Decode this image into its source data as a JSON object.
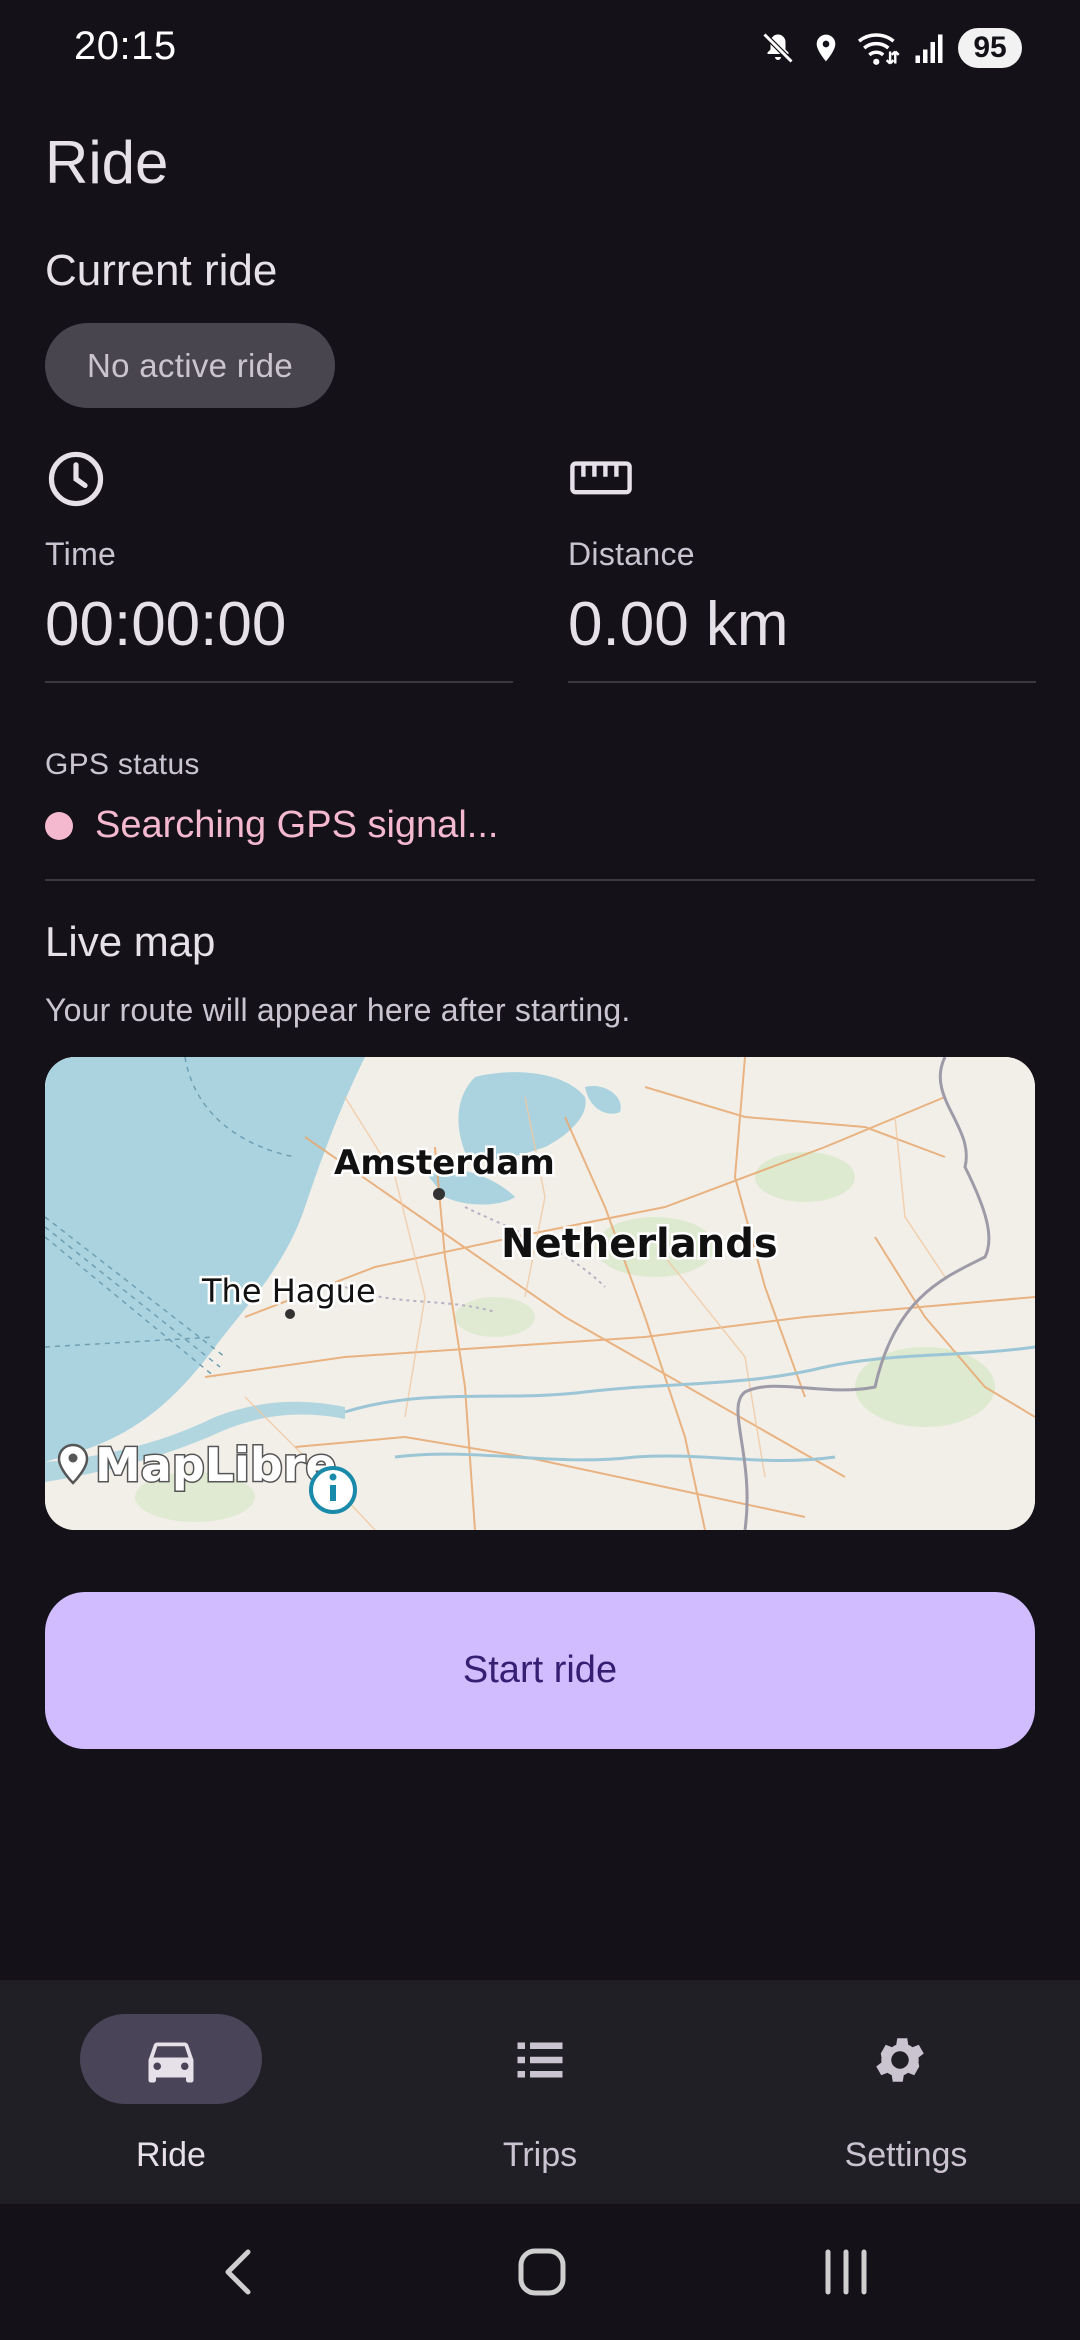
{
  "status_bar": {
    "time": "20:15",
    "battery": "95",
    "icons": [
      "mute-icon",
      "location-icon",
      "wifi-icon",
      "signal-icon"
    ]
  },
  "page": {
    "title": "Ride"
  },
  "current_ride": {
    "heading": "Current ride",
    "status_chip": "No active ride"
  },
  "stats": {
    "time": {
      "label": "Time",
      "value": "00:00:00",
      "icon": "clock-icon"
    },
    "distance": {
      "label": "Distance",
      "value": "0.00 km",
      "icon": "ruler-icon"
    }
  },
  "gps": {
    "label": "GPS status",
    "status": "Searching GPS signal...",
    "status_color": "#f4b8cf"
  },
  "live_map": {
    "heading": "Live map",
    "subtext": "Your route will appear here after starting.",
    "labels": {
      "amsterdam": "Amsterdam",
      "netherlands": "Netherlands",
      "the_hague": "The Hague"
    },
    "attribution": "MapLibre"
  },
  "actions": {
    "start_ride": "Start ride"
  },
  "bottom_nav": {
    "items": [
      {
        "label": "Ride",
        "icon": "car-icon",
        "selected": true
      },
      {
        "label": "Trips",
        "icon": "list-icon",
        "selected": false
      },
      {
        "label": "Settings",
        "icon": "gear-icon",
        "selected": false
      }
    ]
  },
  "colors": {
    "background": "#141218",
    "primary_container": "#d0bcff",
    "on_primary_container": "#381e72",
    "nav_indicator": "#4a4458"
  }
}
